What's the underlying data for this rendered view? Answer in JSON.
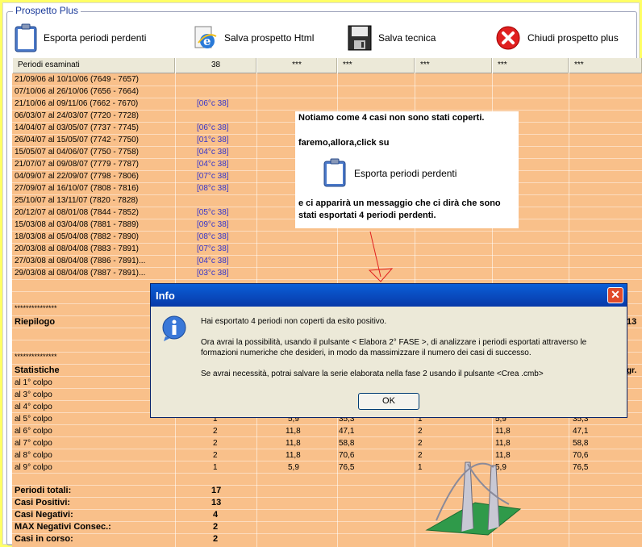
{
  "window": {
    "group_title": "Prospetto Plus"
  },
  "toolbar": {
    "export_label": "Esporta periodi perdenti",
    "save_html_label": "Salva prospetto Html",
    "save_tech_label": "Salva tecnica",
    "close_label": "Chiudi prospetto plus"
  },
  "header": {
    "col1": "Periodi esaminati",
    "col2": "38",
    "col3": "***",
    "col4": "***",
    "col5": "***",
    "col6": "***",
    "col7": "***"
  },
  "periods": [
    {
      "range": "21/09/06 al 10/10/06  (7649 - 7657)",
      "hint": ""
    },
    {
      "range": "07/10/06 al 26/10/06  (7656 - 7664)",
      "hint": ""
    },
    {
      "range": "21/10/06 al 09/11/06  (7662 - 7670)",
      "hint": "[06°c 38]"
    },
    {
      "range": "06/03/07 al 24/03/07  (7720 - 7728)",
      "hint": ""
    },
    {
      "range": "14/04/07 al 03/05/07  (7737 - 7745)",
      "hint": "[06°c 38]"
    },
    {
      "range": "26/04/07 al 15/05/07  (7742 - 7750)",
      "hint": "[01°c 38]"
    },
    {
      "range": "15/05/07 al 04/06/07  (7750 - 7758)",
      "hint": "[04°c 38]"
    },
    {
      "range": "21/07/07 al 09/08/07  (7779 - 7787)",
      "hint": "[04°c 38]"
    },
    {
      "range": "04/09/07 al 22/09/07  (7798 - 7806)",
      "hint": "[07°c 38]"
    },
    {
      "range": "27/09/07 al 16/10/07  (7808 - 7816)",
      "hint": "[08°c 38]"
    },
    {
      "range": "25/10/07 al 13/11/07  (7820 - 7828)",
      "hint": ""
    },
    {
      "range": "20/12/07 al 08/01/08  (7844 - 7852)",
      "hint": "[05°c 38]"
    },
    {
      "range": "15/03/08 al 03/04/08  (7881 - 7889)",
      "hint": "[09°c 38]"
    },
    {
      "range": "18/03/08 al 05/04/08  (7882 - 7890)",
      "hint": "[08°c 38]"
    },
    {
      "range": "20/03/08 al 08/04/08  (7883 - 7891)",
      "hint": "[07°c 38]"
    },
    {
      "range": "27/03/08 al 08/04/08  (7886 - 7891)...",
      "hint": "[04°c 38]"
    },
    {
      "range": "29/03/08 al 08/04/08  (7887 - 7891)...",
      "hint": "[03°c 38]"
    }
  ],
  "separator1": "***************",
  "riepilogo": {
    "label": "Riepilogo",
    "right_value": "13"
  },
  "separator2": "***************",
  "statistiche": {
    "label": "Statistiche",
    "right_value": "gr."
  },
  "colpi": [
    {
      "label": "al 1° colpo",
      "c2": "",
      "c3": "",
      "c4": "",
      "c5": "",
      "c6": "",
      "c7": ""
    },
    {
      "label": "al 3° colpo",
      "c2": "",
      "c3": "",
      "c4": "",
      "c5": "",
      "c6": "",
      "c7": ""
    },
    {
      "label": "al 4° colpo",
      "c2": "",
      "c3": "",
      "c4": "",
      "c5": "",
      "c6": "",
      "c7": ""
    },
    {
      "label": "al 5° colpo",
      "c2": "1",
      "c3": "5,9",
      "c4": "35,3",
      "c5": "1",
      "c6": "5,9",
      "c7": "35,3"
    },
    {
      "label": "al 6° colpo",
      "c2": "2",
      "c3": "11,8",
      "c4": "47,1",
      "c5": "2",
      "c6": "11,8",
      "c7": "47,1"
    },
    {
      "label": "al 7° colpo",
      "c2": "2",
      "c3": "11,8",
      "c4": "58,8",
      "c5": "2",
      "c6": "11,8",
      "c7": "58,8"
    },
    {
      "label": "al 8° colpo",
      "c2": "2",
      "c3": "11,8",
      "c4": "70,6",
      "c5": "2",
      "c6": "11,8",
      "c7": "70,6"
    },
    {
      "label": "al 9° colpo",
      "c2": "1",
      "c3": "5,9",
      "c4": "76,5",
      "c5": "1",
      "c6": "5,9",
      "c7": "76,5"
    }
  ],
  "totals": [
    {
      "label": "Periodi totali:",
      "value": "17"
    },
    {
      "label": "Casi Positivi:",
      "value": "13"
    },
    {
      "label": "Casi Negativi:",
      "value": "4"
    },
    {
      "label": "MAX Negativi Consec.:",
      "value": "2"
    },
    {
      "label": "Casi in corso:",
      "value": "2"
    }
  ],
  "note": {
    "line1": "Notiamo come 4 casi non sono stati coperti.",
    "line2": "faremo,allora,click su",
    "button_label": "Esporta periodi perdenti",
    "line3": "e ci apparirà un messaggio che ci dirà che sono",
    "line4": "stati esportati 4 periodi perdenti."
  },
  "dialog": {
    "title": "Info",
    "close_symbol": "✕",
    "msg1": "Hai esportato 4 periodi non coperti da esito positivo.",
    "msg2a": "Ora avrai la possibilità, usando il pulsante < Elabora 2° FASE >, di analizzare i periodi esportati attraverso le",
    "msg2b": "formazioni numeriche che desideri, in modo da massimizzare il numero dei casi di successo.",
    "msg3": "Se avrai necessità, potrai salvare la serie elaborata nella fase 2 usando il pulsante <Crea .cmb>",
    "ok_label": "OK"
  },
  "colors": {
    "table_bg": "#f9c08a",
    "hint_text": "#3333cc",
    "frame_bg": "#ffff66",
    "title_bar": "#0a5fd8",
    "close_red": "#e04a2a"
  },
  "icons": {
    "export": "clipboard-icon",
    "save_html": "ie-globe-icon",
    "save_tech": "floppy-disk-icon",
    "close": "red-x-circle-icon",
    "dialog_info": "info-icon",
    "logo": "bridge-logo-icon"
  }
}
